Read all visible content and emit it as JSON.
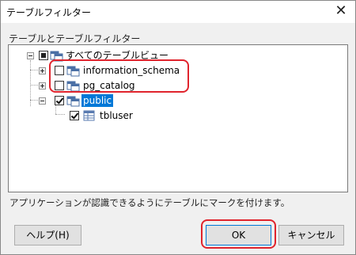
{
  "window": {
    "title": "テーブルフィルター",
    "close_glyph": "✕"
  },
  "section_label": "テーブルとテーブルフィルター",
  "tree": {
    "root": "すべてのテーブルビュー",
    "schemas": [
      {
        "label": "information_schema"
      },
      {
        "label": "pg_catalog"
      },
      {
        "label": "public"
      }
    ],
    "tables": [
      {
        "label": "tbluser"
      }
    ]
  },
  "hint": "アプリケーションが認識できるようにテーブルにマークを付けます。",
  "buttons": {
    "help": "ヘルプ(H)",
    "ok": "OK",
    "cancel": "キャンセル"
  },
  "colors": {
    "selection": "#0078d7",
    "annotation": "#e0242d"
  },
  "icons": [
    "close-icon",
    "expand-icon",
    "collapse-icon",
    "checkbox-icon",
    "schema-icon",
    "table-icon"
  ]
}
